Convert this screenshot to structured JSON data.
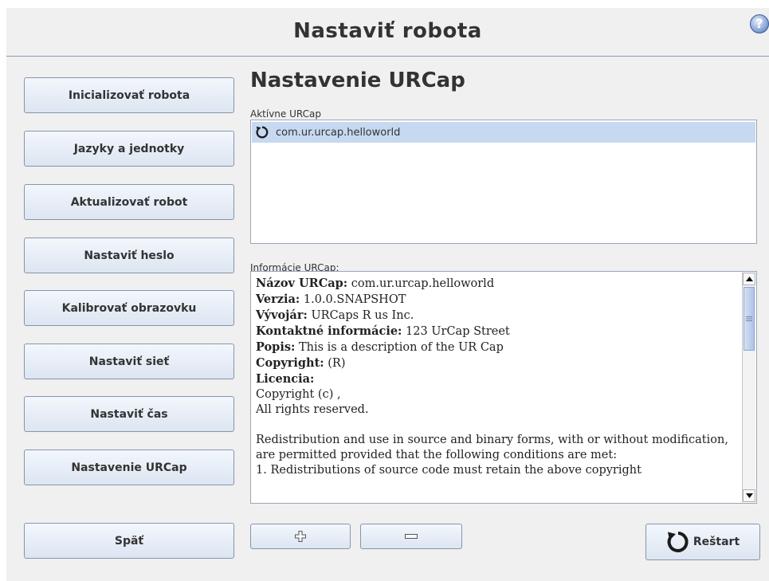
{
  "header": {
    "title": "Nastaviť robota",
    "help_icon": "question-mark-icon"
  },
  "sidebar": {
    "items": [
      {
        "label": "Inicializovať robota"
      },
      {
        "label": "Jazyky a jednotky"
      },
      {
        "label": "Aktualizovať robot"
      },
      {
        "label": "Nastaviť heslo"
      },
      {
        "label": "Kalibrovať obrazovku"
      },
      {
        "label": "Nastaviť sieť"
      },
      {
        "label": "Nastaviť čas"
      },
      {
        "label": "Nastavenie URCap"
      }
    ],
    "back_label": "Späť"
  },
  "main": {
    "heading": "Nastavenie URCap",
    "active_label": "Aktívne URCap",
    "active_items": [
      {
        "name": "com.ur.urcap.helloworld",
        "icon": "refresh-icon"
      }
    ],
    "info_label": "Informácie URCap:",
    "info": {
      "name_key": "Názov URCap:",
      "name_val": "com.ur.urcap.helloworld",
      "version_key": "Verzia:",
      "version_val": "1.0.0.SNAPSHOT",
      "developer_key": "Vývojár:",
      "developer_val": "URCaps R us Inc.",
      "contact_key": "Kontaktné informácie:",
      "contact_val": "123 UrCap Street",
      "description_key": "Popis:",
      "description_val": "This is a description of the UR Cap",
      "copyright_key": "Copyright:",
      "copyright_val": "(R)",
      "license_key": "Licencia:",
      "license_line1": "Copyright (c) ,",
      "license_line2": "All rights reserved.",
      "license_para1": "Redistribution and use in source and binary forms, with or without modification, are permitted provided that the following conditions are met:",
      "license_para2": "1. Redistributions of source code must retain the above copyright"
    }
  },
  "actions": {
    "add_icon": "plus-icon",
    "remove_icon": "minus-icon",
    "restart_label": "Reštart"
  },
  "colors": {
    "accent": "#c6d9f0",
    "border": "#8795ab",
    "divider": "#8a9cb8"
  }
}
